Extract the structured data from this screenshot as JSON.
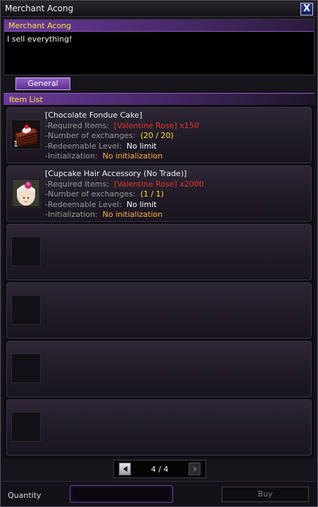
{
  "window": {
    "title": "Merchant Acong",
    "close_label": "X"
  },
  "npc": {
    "name": "Merchant Acong",
    "greeting": "I sell everything!"
  },
  "tabs": [
    {
      "label": "General"
    }
  ],
  "list": {
    "header": "Item List",
    "items": [
      {
        "name": "[Chocolate Fondue Cake]",
        "icon": "chocolate-cake-icon",
        "count": "1",
        "required_label": "-Required Items:",
        "required_item": "[Valentine Rose]",
        "required_qty": "x150",
        "exchanges_label": "-Number of exchanges:",
        "exchanges_value": "(20 / 20)",
        "level_label": "-Redeemable Level:",
        "level_value": "No limit",
        "init_label": "-Initialization:",
        "init_value": "No initialization"
      },
      {
        "name": "[Cupcake Hair Accessory (No Trade)]",
        "icon": "cupcake-hair-accessory-icon",
        "count": "",
        "required_label": "-Required Items:",
        "required_item": "[Valentine Rose]",
        "required_qty": "x2000",
        "exchanges_label": "-Number of exchanges:",
        "exchanges_value": "(1 / 1)",
        "level_label": "-Redeemable Level:",
        "level_value": "No limit",
        "init_label": "-Initialization:",
        "init_value": "No initialization"
      }
    ],
    "empty_slots": 4
  },
  "pager": {
    "label": "4 / 4"
  },
  "footer": {
    "quantity_label": "Quantity",
    "buy_label": "Buy"
  },
  "colors": {
    "accent_purple": "#6a3a9a",
    "highlight_yellow": "#ffe23a",
    "required_red": "#e8362a",
    "init_orange": "#ffb048"
  }
}
